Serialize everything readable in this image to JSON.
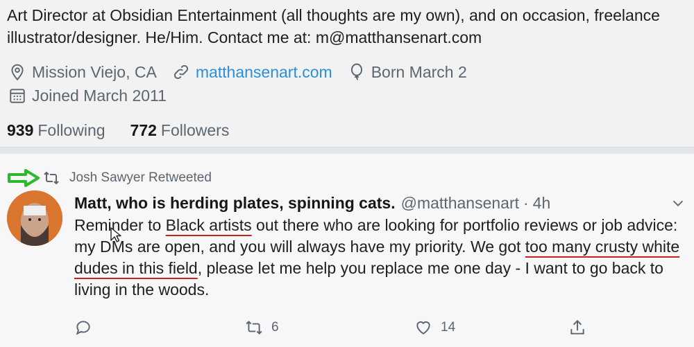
{
  "profile": {
    "bio": "Art Director at Obsidian Entertainment (all thoughts are my own), and on occasion, freelance illustrator/designer. He/Him. Contact me at: m@matthansenart.com",
    "location": "Mission Viejo, CA",
    "website": "matthansenart.com",
    "birthday": "Born March 2",
    "joined": "Joined March 2011",
    "following_count": "939",
    "following_label": "Following",
    "followers_count": "772",
    "followers_label": "Followers",
    "icons": [
      "location-pin-icon",
      "link-icon",
      "balloon-icon",
      "calendar-icon"
    ]
  },
  "tweet": {
    "retweeted_by": "Josh Sawyer Retweeted",
    "author_name": "Matt, who is herding plates, spinning cats.",
    "handle": "@matthansenart",
    "separator": "·",
    "time": "4h",
    "text_parts": {
      "p1": "Reminder to ",
      "p2": "Black artists",
      "p3": " out there who are looking for portfolio reviews or job advice: my DMs are open, and you will always have my priority. We got ",
      "p4": "too many crusty white dudes in this field",
      "p5": ", please let me help you replace me one day - I want to go back to living in the woods."
    },
    "actions": {
      "reply_count": "",
      "retweet_count": "6",
      "like_count": "14"
    },
    "colors": {
      "highlight_arrow": "#2eb82e",
      "underline": "#cc1f1f",
      "link": "#2a8fd8"
    }
  }
}
